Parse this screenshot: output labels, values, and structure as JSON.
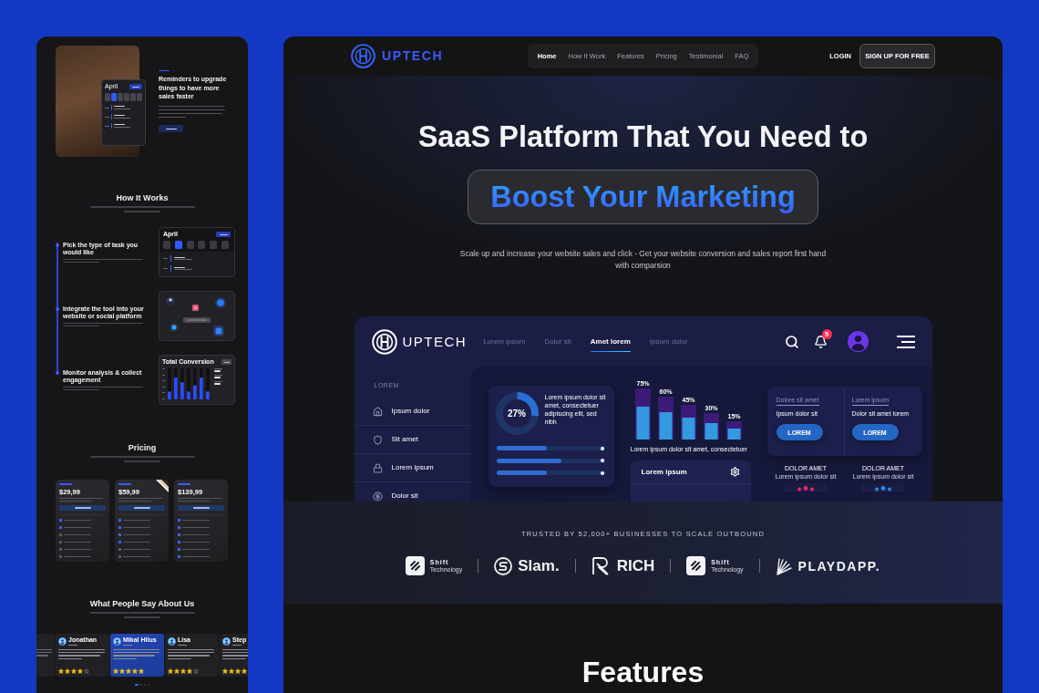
{
  "left_page": {
    "hero": {
      "title": "Reminders to upgrade things to have more sales faster",
      "calendar": {
        "month": "April",
        "days": [
          {
            "selected": false
          },
          {
            "selected": true
          },
          {
            "selected": false
          },
          {
            "selected": false
          },
          {
            "selected": false
          },
          {
            "selected": false
          }
        ]
      }
    },
    "how_it_works": {
      "title": "How It Works",
      "steps": [
        {
          "title": "Pick the type of task you would like",
          "kind": "calendar",
          "month": "April",
          "days": [
            {
              "selected": false
            },
            {
              "selected": true
            },
            {
              "selected": false
            },
            {
              "selected": false
            },
            {
              "selected": false
            },
            {
              "selected": false
            }
          ]
        },
        {
          "title": "Integrate the tool into your website or social platform",
          "kind": "integrations"
        },
        {
          "title": "Monitor analysis & collect engagement",
          "kind": "chart",
          "chart_title": "Total Conversion"
        }
      ]
    },
    "pricing": {
      "title": "Pricing",
      "plans": [
        {
          "price": "$29,99",
          "featured": false,
          "features": [
            {
              "included": true
            },
            {
              "included": true
            },
            {
              "included": false
            },
            {
              "included": false
            },
            {
              "included": false
            },
            {
              "included": false
            }
          ]
        },
        {
          "price": "$59,99",
          "featured": true,
          "features": [
            {
              "included": true
            },
            {
              "included": true
            },
            {
              "included": true
            },
            {
              "included": true
            },
            {
              "included": false
            },
            {
              "included": false
            }
          ]
        },
        {
          "price": "$139,99",
          "featured": false,
          "features": [
            {
              "included": true
            },
            {
              "included": true
            },
            {
              "included": true
            },
            {
              "included": true
            },
            {
              "included": true
            },
            {
              "included": true
            }
          ]
        }
      ]
    },
    "testimonials": {
      "title": "What People Say About Us",
      "cards": [
        {
          "name": "Jonathan",
          "stars": 4,
          "selected": false
        },
        {
          "name": "Mikal Hilus",
          "stars": 5,
          "selected": true
        },
        {
          "name": "Lisa",
          "stars": 4,
          "selected": false
        },
        {
          "name": "Step",
          "stars": 4,
          "selected": false
        }
      ],
      "dots": [
        {
          "selected": true
        },
        {
          "selected": false
        },
        {
          "selected": false
        },
        {
          "selected": false
        }
      ]
    }
  },
  "main_page": {
    "nav": {
      "brand": "UPTECH",
      "links": [
        {
          "label": "Home",
          "selected": true
        },
        {
          "label": "How It Work",
          "selected": false
        },
        {
          "label": "Features",
          "selected": false
        },
        {
          "label": "Pricing",
          "selected": false
        },
        {
          "label": "Testimonial",
          "selected": false
        },
        {
          "label": "FAQ",
          "selected": false
        }
      ],
      "login": "LOGIN",
      "cta": "SIGN UP FOR FREE"
    },
    "hero": {
      "title": "SaaS Platform That You Need to",
      "highlight": "Boost Your Marketing",
      "subtitle": "Scale up and increase your website sales and click - Get your website conversion and sales report first hand with comparsion"
    },
    "dashboard": {
      "brand": "UPTECH",
      "links": [
        {
          "label": "Lorem ipsum",
          "selected": false
        },
        {
          "label": "Dolor sit",
          "selected": false
        },
        {
          "label": "Amet lorem",
          "selected": true
        },
        {
          "label": "Ipsum dolor",
          "selected": false
        }
      ],
      "notification_count": "5",
      "sidebar": {
        "heading": "LOREM",
        "items": [
          {
            "label": "Ipsum dolor",
            "kind": "home"
          },
          {
            "label": "Sit amet",
            "kind": "shield"
          },
          {
            "label": "Lorem ipsum",
            "kind": "lock"
          },
          {
            "label": "Dolor sit",
            "kind": "dollar"
          }
        ]
      },
      "summary": {
        "percent": "27%",
        "level": 0.27,
        "text": "Lorem ipsum dolor sit amet, consectetuer adipiscing elit, sed nibh",
        "bars": [
          {
            "level": 0.47
          },
          {
            "level": 0.6
          },
          {
            "level": 0.47
          }
        ]
      },
      "bar_chart": {
        "bars": [
          {
            "label": "75%"
          },
          {
            "label": "60%"
          },
          {
            "label": "45%"
          },
          {
            "label": "30%"
          },
          {
            "label": "15%"
          }
        ],
        "caption": "Lorem ipsum dolor sit amet, consectetuer"
      },
      "panel": {
        "title": "Lorem ipsum"
      },
      "offers": [
        {
          "label": "Dolore sit amet",
          "title": "Ipsum dolor sit",
          "button": "LOREM"
        },
        {
          "label": "Lorem ipsum",
          "title": "Dolor sit amet lorem",
          "button": "LOREM"
        }
      ],
      "dials": [
        {
          "title": "DOLOR AMET",
          "text": "Lorem ipsum dolor sit",
          "color": "#e8265e"
        },
        {
          "title": "DOLOR AMET",
          "text": "Lorem ipsum dolor sit",
          "color": "#1e8fe8"
        }
      ]
    },
    "trusted": {
      "title": "TRUSTED BY 52,000+ BUSINESSES TO SCALE OUTBOUND",
      "logos": [
        {
          "kind": "shift",
          "name": "Shift",
          "tagline": "Technology"
        },
        {
          "kind": "slam",
          "name": "Slam."
        },
        {
          "kind": "rich",
          "name": "RICH"
        },
        {
          "kind": "shift",
          "name": "Shift",
          "tagline": "Technology"
        },
        {
          "kind": "playdapp",
          "name": "PLAYDAPP."
        }
      ]
    },
    "features": {
      "title": "Features"
    }
  }
}
